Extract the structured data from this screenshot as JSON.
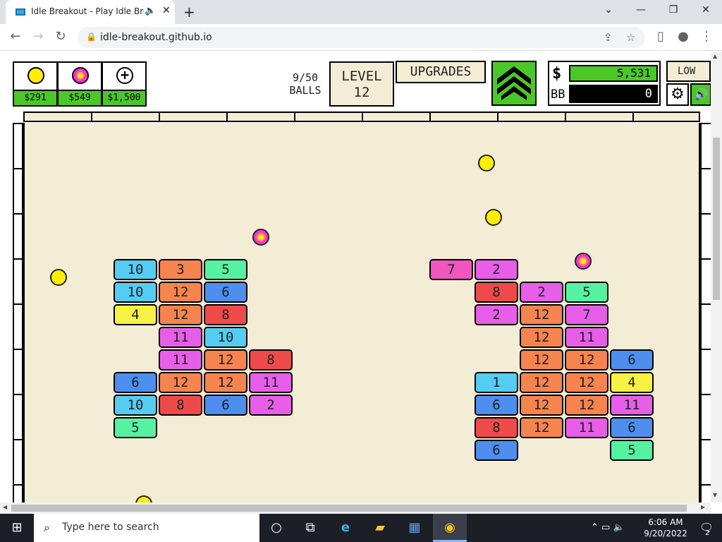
{
  "browser": {
    "tab_title": "Idle Breakout - Play Idle Break",
    "tab_close": "✕",
    "tab_audio_icon": "🔈",
    "new_tab": "+",
    "url": "idle-breakout.github.io",
    "window_controls": {
      "minimize": "—",
      "maximize": "❐",
      "close": "✕",
      "tabsearch": "⌄"
    },
    "nav": {
      "back": "←",
      "forward": "→",
      "reload": "↻",
      "lock": "🔒",
      "share": "⇪",
      "star": "☆",
      "sidepanel": "▯",
      "profile": "●",
      "menu": "⋮"
    }
  },
  "game": {
    "ball_shop": [
      {
        "name": "basic-ball",
        "price": "$291",
        "color": "#ffee00"
      },
      {
        "name": "plasma-ball",
        "price": "$549",
        "color": "#ff33cc"
      },
      {
        "name": "add-ball",
        "price": "$1,500",
        "color": "#ffffff"
      }
    ],
    "add_ball_glyph": "+",
    "balls_count": "9/50",
    "balls_label": "BALLS",
    "level_label": "LEVEL",
    "level_value": "12",
    "upgrades_label": "UPGRADES",
    "money_symbol": "$",
    "money_value": "5,531",
    "bb_symbol": "BB",
    "bb_value": "0",
    "quality_label": "LOW",
    "settings_glyph": "⚙",
    "sound_glyph": "🔊",
    "colors": {
      "cyan": "#55ccf2",
      "orange": "#f5844f",
      "green": "#55f2a2",
      "blue": "#4d8eee",
      "yellow": "#f7f244",
      "red": "#ee4a4a",
      "magenta": "#e75ee8",
      "pink": "#f055c0",
      "field": "#f4edd6",
      "accent_green": "#4bc728"
    },
    "bricks": [
      {
        "value": "10",
        "color": "cyan"
      },
      {
        "value": "3",
        "color": "orange"
      },
      {
        "value": "5",
        "color": "green"
      },
      {
        "value": "10",
        "color": "cyan"
      },
      {
        "value": "12",
        "color": "orange"
      },
      {
        "value": "6",
        "color": "blue"
      },
      {
        "value": "4",
        "color": "yellow"
      },
      {
        "value": "12",
        "color": "orange"
      },
      {
        "value": "8",
        "color": "red"
      },
      {
        "value": "11",
        "color": "magenta"
      },
      {
        "value": "10",
        "color": "cyan"
      },
      {
        "value": "11",
        "color": "magenta"
      },
      {
        "value": "12",
        "color": "orange"
      },
      {
        "value": "8",
        "color": "red"
      },
      {
        "value": "6",
        "color": "blue"
      },
      {
        "value": "12",
        "color": "orange"
      },
      {
        "value": "12",
        "color": "orange"
      },
      {
        "value": "11",
        "color": "magenta"
      },
      {
        "value": "10",
        "color": "cyan"
      },
      {
        "value": "8",
        "color": "red"
      },
      {
        "value": "6",
        "color": "blue"
      },
      {
        "value": "2",
        "color": "magenta"
      },
      {
        "value": "5",
        "color": "green"
      },
      {
        "value": "7",
        "color": "pink"
      },
      {
        "value": "2",
        "color": "magenta"
      },
      {
        "value": "8",
        "color": "red"
      },
      {
        "value": "2",
        "color": "magenta"
      },
      {
        "value": "5",
        "color": "green"
      },
      {
        "value": "2",
        "color": "magenta"
      },
      {
        "value": "12",
        "color": "orange"
      },
      {
        "value": "7",
        "color": "magenta"
      },
      {
        "value": "12",
        "color": "orange"
      },
      {
        "value": "11",
        "color": "magenta"
      },
      {
        "value": "12",
        "color": "orange"
      },
      {
        "value": "12",
        "color": "orange"
      },
      {
        "value": "6",
        "color": "blue"
      },
      {
        "value": "1",
        "color": "cyan"
      },
      {
        "value": "12",
        "color": "orange"
      },
      {
        "value": "12",
        "color": "orange"
      },
      {
        "value": "4",
        "color": "yellow"
      },
      {
        "value": "6",
        "color": "blue"
      },
      {
        "value": "12",
        "color": "orange"
      },
      {
        "value": "12",
        "color": "orange"
      },
      {
        "value": "11",
        "color": "magenta"
      },
      {
        "value": "8",
        "color": "red"
      },
      {
        "value": "12",
        "color": "orange"
      },
      {
        "value": "11",
        "color": "magenta"
      },
      {
        "value": "6",
        "color": "blue"
      },
      {
        "value": "6",
        "color": "blue"
      },
      {
        "value": "5",
        "color": "green"
      }
    ]
  },
  "taskbar": {
    "start_icon": "⊞",
    "search_icon": "⌕",
    "search_placeholder": "Type here to search",
    "cortana_icon": "○",
    "taskview_icon": "⧉",
    "edge_icon": "e",
    "explorer_icon": "▰",
    "store_icon": "▦",
    "chrome_icon": "◉",
    "tray_icons": "⌃ ▭ 🔈",
    "time": "6:06 AM",
    "date": "9/20/2022",
    "notification_icon": "🗨",
    "notification_count": "2"
  }
}
